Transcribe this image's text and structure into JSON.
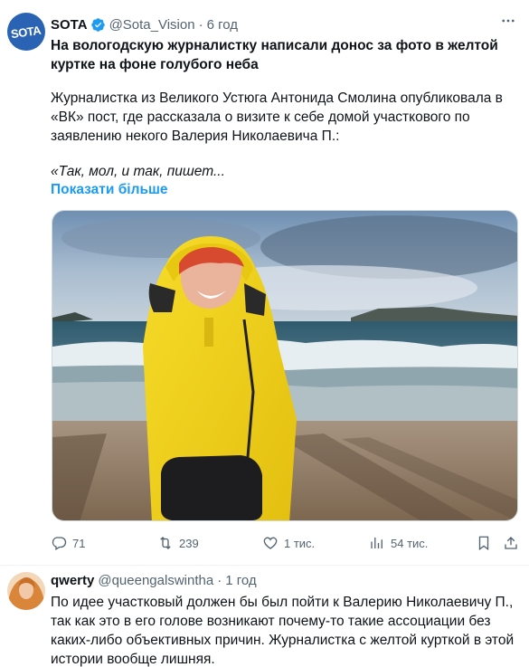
{
  "tweet": {
    "author_name": "SOTA",
    "author_handle": "@Sota_Vision",
    "separator": "·",
    "time": "6 год",
    "avatar_text": "SOTA",
    "headline": "На вологодскую журналистку написали донос за фото в желтой куртке на фоне голубого неба",
    "body": "Журналистка из Великого Устюга Антонида Смолина опубликовала в «ВК» пост, где рассказала о визите к себе домой участкового по заявлению некого Валерия Николаевича П.:",
    "quote": "«Так, мол, и так, пишет...",
    "show_more": "Показати більше",
    "actions": {
      "replies": "71",
      "reposts": "239",
      "likes": "1 тис.",
      "views": "54 тис."
    }
  },
  "reply": {
    "author_name": "qwerty",
    "author_handle": "@queengalswintha",
    "separator": "·",
    "time": "1 год",
    "text": "По идее участковый должен бы был пойти к Валерию Николаевичу П., так как это в его голове возникают почему-то такие ассоциации без каких-либо объективных причин. Журналистка с желтой курткой в этой истории вообще лишняя."
  },
  "colors": {
    "accent": "#1d9bf0",
    "secondary_text": "#536471",
    "brand_avatar": "#2a63b3",
    "jacket": "#f2d21c"
  },
  "icons": [
    "verified-badge-icon",
    "more-icon",
    "reply-icon",
    "repost-icon",
    "like-icon",
    "views-icon",
    "bookmark-icon",
    "share-icon"
  ]
}
